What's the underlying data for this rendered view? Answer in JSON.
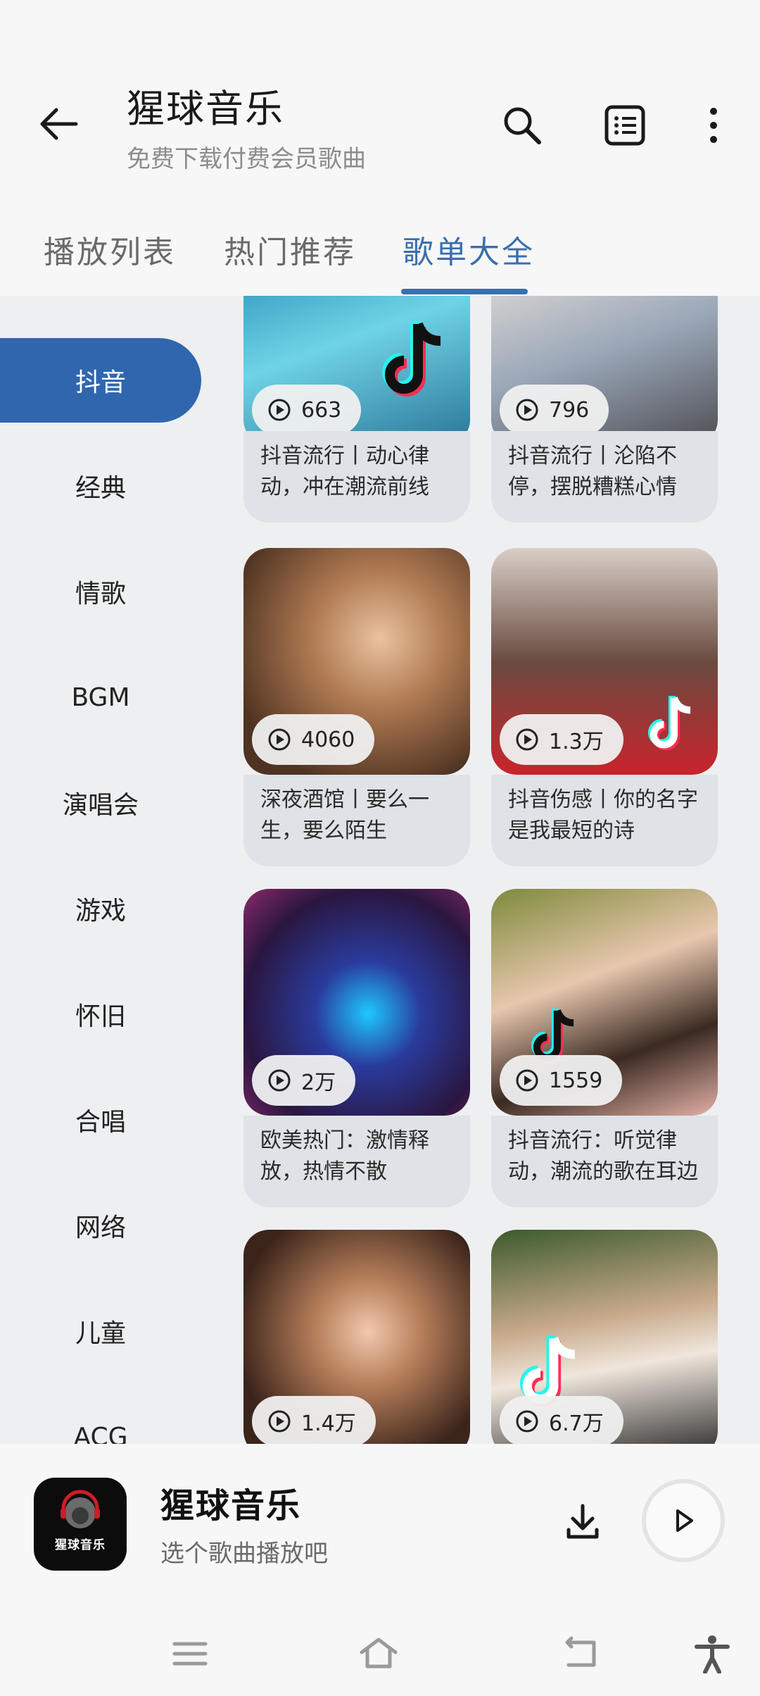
{
  "header": {
    "title": "猩球音乐",
    "subtitle": "免费下载付费会员歌曲",
    "icons": [
      "back-arrow-icon",
      "search-icon",
      "list-icon",
      "more-vertical-icon"
    ]
  },
  "tabs": [
    {
      "label": "播放列表",
      "active": false
    },
    {
      "label": "热门推荐",
      "active": false
    },
    {
      "label": "歌单大全",
      "active": true
    }
  ],
  "categories": [
    {
      "label": "抖音",
      "active": true
    },
    {
      "label": "经典",
      "active": false
    },
    {
      "label": "情歌",
      "active": false
    },
    {
      "label": "BGM",
      "active": false
    },
    {
      "label": "演唱会",
      "active": false
    },
    {
      "label": "游戏",
      "active": false
    },
    {
      "label": "怀旧",
      "active": false
    },
    {
      "label": "合唱",
      "active": false
    },
    {
      "label": "网络",
      "active": false
    },
    {
      "label": "儿童",
      "active": false
    },
    {
      "label": "ACG",
      "active": false
    }
  ],
  "playlists": [
    {
      "count": "663",
      "desc": "抖音流行丨动心律动，冲在潮流前线"
    },
    {
      "count": "796",
      "desc": "抖音流行丨沦陷不停，摆脱糟糕心情"
    },
    {
      "count": "4060",
      "desc": "深夜酒馆丨要么一生，要么陌生"
    },
    {
      "count": "1.3万",
      "desc": "抖音伤感丨你的名字是我最短的诗"
    },
    {
      "count": "2万",
      "desc": "欧美热门：激情释放，热情不散"
    },
    {
      "count": "1559",
      "desc": "抖音流行：听觉律动，潮流的歌在耳边"
    },
    {
      "count": "1.4万",
      "desc": ""
    },
    {
      "count": "6.7万",
      "desc": ""
    }
  ],
  "player": {
    "title": "猩球音乐",
    "subtitle": "选个歌曲播放吧",
    "logo_text": "猩球音乐"
  },
  "colors": {
    "accent": "#2f66ae",
    "tab_active": "#3a6fae",
    "content_bg": "#eeeff1"
  }
}
